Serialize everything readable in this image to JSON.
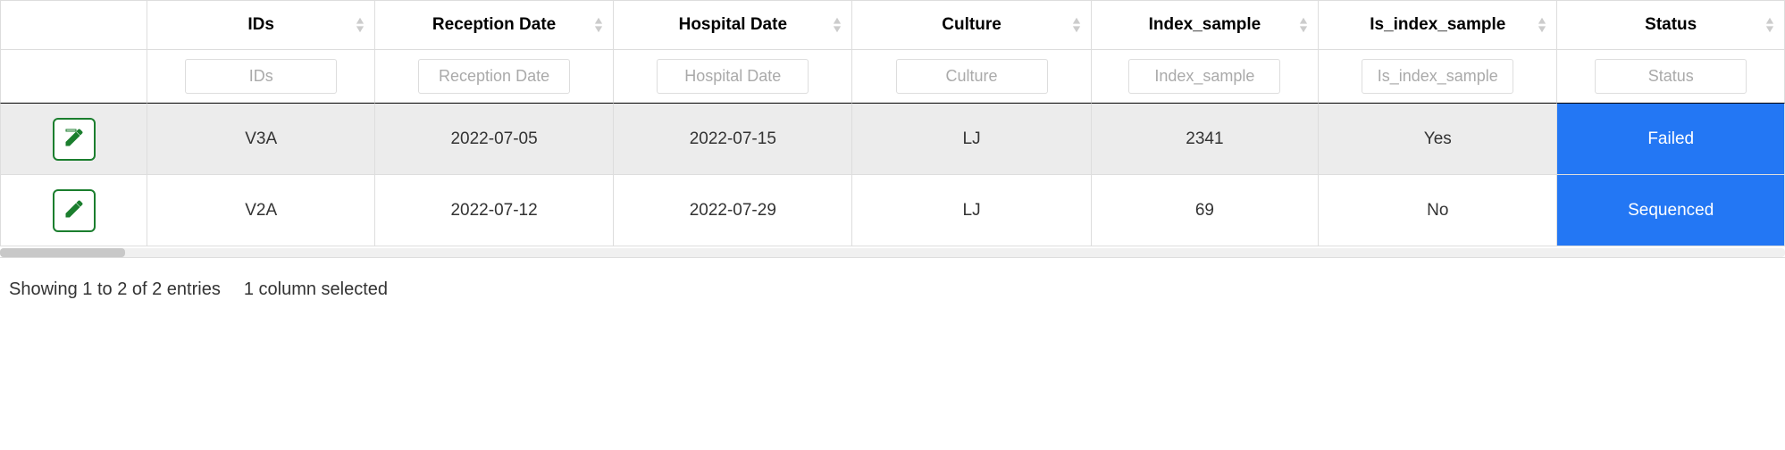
{
  "columns": [
    {
      "key": "edit",
      "label": "",
      "placeholder": ""
    },
    {
      "key": "ids",
      "label": "IDs",
      "placeholder": "IDs"
    },
    {
      "key": "recep",
      "label": "Reception Date",
      "placeholder": "Reception Date"
    },
    {
      "key": "hosp",
      "label": "Hospital Date",
      "placeholder": "Hospital Date"
    },
    {
      "key": "cult",
      "label": "Culture",
      "placeholder": "Culture"
    },
    {
      "key": "index",
      "label": "Index_sample",
      "placeholder": "Index_sample"
    },
    {
      "key": "isidx",
      "label": "Is_index_sample",
      "placeholder": "Is_index_sample"
    },
    {
      "key": "status",
      "label": "Status",
      "placeholder": "Status"
    }
  ],
  "rows": [
    {
      "selected": true,
      "ids": "V3A",
      "recep": "2022-07-05",
      "hosp": "2022-07-15",
      "cult": "LJ",
      "index": "2341",
      "isidx": "Yes",
      "status": "Failed"
    },
    {
      "selected": false,
      "ids": "V2A",
      "recep": "2022-07-12",
      "hosp": "2022-07-29",
      "cult": "LJ",
      "index": "69",
      "isidx": "No",
      "status": "Sequenced"
    }
  ],
  "footer": {
    "entries_info": "Showing 1 to 2 of 2 entries",
    "selection_info": "1 column selected"
  }
}
